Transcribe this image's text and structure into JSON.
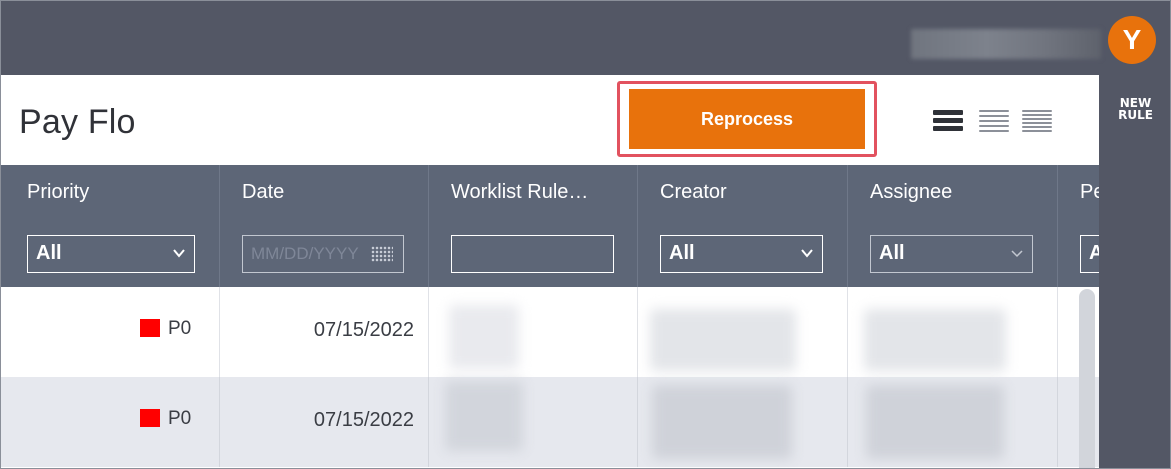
{
  "user": {
    "avatar_initial": "Y"
  },
  "rail": {
    "new_rule_line1": "NEW",
    "new_rule_line2": "RULE"
  },
  "header": {
    "title": "Pay Flo",
    "reprocess_label": "Reprocess"
  },
  "columns": [
    {
      "label": "Priority",
      "filter_type": "select",
      "filter_value": "All"
    },
    {
      "label": "Date",
      "filter_type": "date",
      "filter_placeholder": "MM/DD/YYYY"
    },
    {
      "label": "Worklist Rule…",
      "filter_type": "text",
      "filter_value": ""
    },
    {
      "label": "Creator",
      "filter_type": "select",
      "filter_value": "All"
    },
    {
      "label": "Assignee",
      "filter_type": "select",
      "filter_value": "All"
    },
    {
      "label": "Pe",
      "filter_type": "select",
      "filter_value": "A"
    }
  ],
  "rows": [
    {
      "priority": "P0",
      "priority_color": "#ff0000",
      "date": "07/15/2022"
    },
    {
      "priority": "P0",
      "priority_color": "#ff0000",
      "date": "07/15/2022"
    }
  ],
  "colors": {
    "topbar": "#535765",
    "accent": "#e8720c",
    "grid_header": "#5d6677",
    "highlight_border": "#e2525f",
    "alt_row": "#e6e8ee"
  },
  "icons": {
    "density_compact": "density-compact-icon",
    "density_normal": "density-normal-icon",
    "density_comfortable": "density-comfortable-icon",
    "calendar": "calendar-icon",
    "chevron": "chevron-down-icon"
  }
}
